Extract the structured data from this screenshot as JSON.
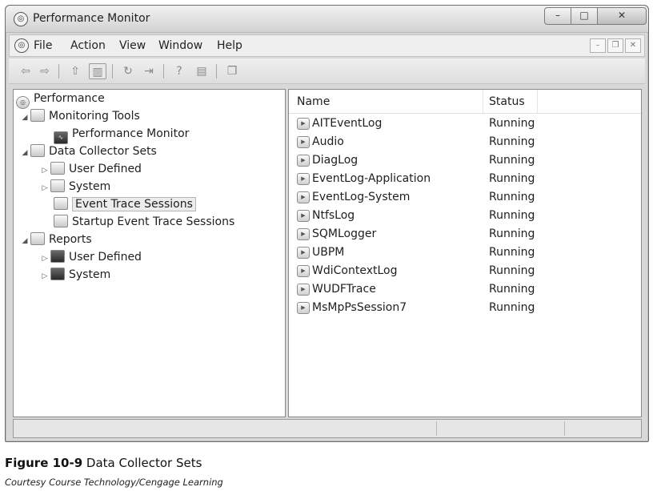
{
  "window": {
    "title": "Performance Monitor",
    "controls": {
      "minimize": "–",
      "maximize": "□",
      "close": "✕"
    }
  },
  "menubar": {
    "items": [
      "File",
      "Action",
      "View",
      "Window",
      "Help"
    ],
    "child_controls": {
      "minimize": "–",
      "restore": "❐",
      "close": "✕"
    }
  },
  "toolbar": {
    "buttons": [
      {
        "icon": "back-arrow-icon",
        "glyph": "⇦"
      },
      {
        "icon": "forward-arrow-icon",
        "glyph": "⇨"
      },
      {
        "icon": "up-folder-icon",
        "glyph": "⇧"
      },
      {
        "icon": "show-hide-tree-icon",
        "glyph": "▥"
      },
      {
        "icon": "refresh-icon",
        "glyph": "↻"
      },
      {
        "icon": "export-list-icon",
        "glyph": "⇥"
      },
      {
        "icon": "help-icon",
        "glyph": "?"
      },
      {
        "icon": "properties-icon",
        "glyph": "▤"
      },
      {
        "icon": "new-window-icon",
        "glyph": "❒"
      }
    ]
  },
  "tree": {
    "items": [
      {
        "label": "Performance",
        "icon": "performance-icon",
        "level": 0,
        "expander": ""
      },
      {
        "label": "Monitoring Tools",
        "icon": "monitoring-tools-icon",
        "level": 1,
        "expander": "◢"
      },
      {
        "label": "Performance Monitor",
        "icon": "performance-monitor-icon",
        "level": 2,
        "expander": ""
      },
      {
        "label": "Data Collector Sets",
        "icon": "data-collector-sets-icon",
        "level": 1,
        "expander": "◢"
      },
      {
        "label": "User Defined",
        "icon": "user-defined-icon",
        "level": 2,
        "expander": "▷"
      },
      {
        "label": "System",
        "icon": "system-icon",
        "level": 2,
        "expander": "▷"
      },
      {
        "label": "Event Trace Sessions",
        "icon": "event-trace-icon",
        "level": 2,
        "expander": "",
        "selected": true
      },
      {
        "label": "Startup Event Trace Sessions",
        "icon": "startup-event-trace-icon",
        "level": 2,
        "expander": ""
      },
      {
        "label": "Reports",
        "icon": "reports-icon",
        "level": 1,
        "expander": "◢"
      },
      {
        "label": "User Defined",
        "icon": "report-user-defined-icon",
        "level": 2,
        "expander": "▷"
      },
      {
        "label": "System",
        "icon": "report-system-icon",
        "level": 2,
        "expander": "▷"
      }
    ]
  },
  "list": {
    "columns": [
      "Name",
      "Status"
    ],
    "rows": [
      {
        "name": "AITEventLog",
        "status": "Running"
      },
      {
        "name": "Audio",
        "status": "Running"
      },
      {
        "name": "DiagLog",
        "status": "Running"
      },
      {
        "name": "EventLog-Application",
        "status": "Running"
      },
      {
        "name": "EventLog-System",
        "status": "Running"
      },
      {
        "name": "NtfsLog",
        "status": "Running"
      },
      {
        "name": "SQMLogger",
        "status": "Running"
      },
      {
        "name": "UBPM",
        "status": "Running"
      },
      {
        "name": "WdiContextLog",
        "status": "Running"
      },
      {
        "name": "WUDFTrace",
        "status": "Running"
      },
      {
        "name": "MsMpPsSession7",
        "status": "Running"
      }
    ]
  },
  "caption": {
    "figure": "Figure 10-9",
    "title": "Data Collector Sets",
    "credit": "Courtesy Course Technology/Cengage Learning"
  }
}
